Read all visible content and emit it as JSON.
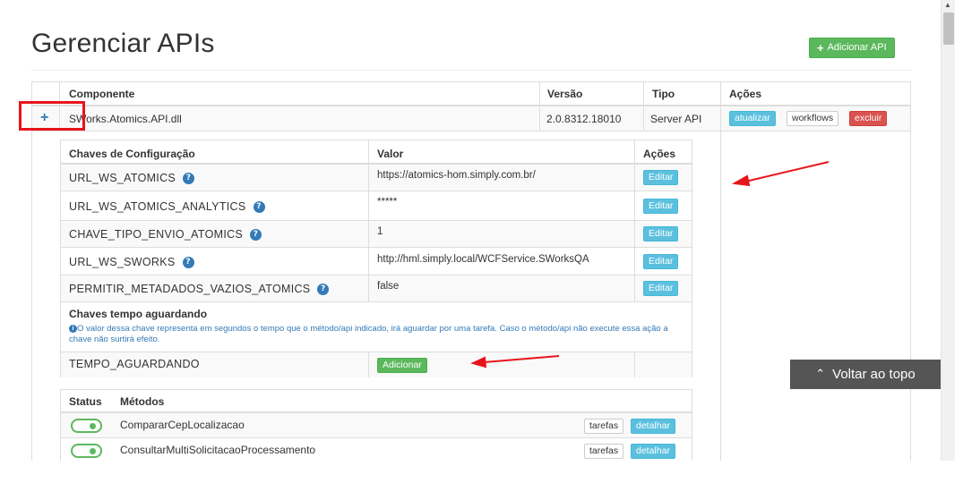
{
  "page": {
    "title": "Gerenciar APIs",
    "add_api_label": "Adicionar API",
    "back_to_top_label": "Voltar ao topo"
  },
  "colors": {
    "primary": "#337ab7",
    "success": "#5cb85c",
    "info": "#5bc0de",
    "danger": "#d9534f",
    "annotation_red": "#e8141b"
  },
  "main_table": {
    "headers": {
      "componente": "Componente",
      "versao": "Versão",
      "tipo": "Tipo",
      "acoes": "Ações"
    },
    "row": {
      "componente": "SWorks.Atomics.API.dll",
      "versao": "2.0.8312.18010",
      "tipo": "Server API",
      "actions": {
        "atualizar": "atualizar",
        "workflows": "workflows",
        "excluir": "excluir"
      }
    }
  },
  "config_table": {
    "headers": {
      "chave": "Chaves de Configuração",
      "valor": "Valor",
      "acoes": "Ações"
    },
    "edit_label": "Editar",
    "rows": [
      {
        "key": "URL_WS_ATOMICS",
        "value": "https://atomics-hom.simply.com.br/"
      },
      {
        "key": "URL_WS_ATOMICS_ANALYTICS",
        "value": "*****"
      },
      {
        "key": "CHAVE_TIPO_ENVIO_ATOMICS",
        "value": "1"
      },
      {
        "key": "URL_WS_SWORKS",
        "value": "http://hml.simply.local/WCFService.SWorksQA"
      },
      {
        "key": "PERMITIR_METADADOS_VAZIOS_ATOMICS",
        "value": "false"
      }
    ],
    "waiting": {
      "title": "Chaves tempo aguardando",
      "note": "O valor dessa chave representa em segundos o tempo que o método/api indicado, irá aguardar por uma tarefa. Caso o método/api não execute essa ação a chave não surtirá efeito.",
      "key": "TEMPO_AGUARDANDO",
      "add_label": "Adicionar"
    }
  },
  "methods_table": {
    "headers": {
      "status": "Status",
      "metodos": "Métodos"
    },
    "tarefas_label": "tarefas",
    "detalhar_label": "detalhar",
    "rows": [
      {
        "name": "CompararCepLocalizacao",
        "enabled": true
      },
      {
        "name": "ConsultarMultiSolicitacaoProcessamento",
        "enabled": true
      }
    ]
  },
  "icons": {
    "expand": "plus-icon",
    "help": "question-circle-icon",
    "info": "info-circle-icon",
    "back_to_top": "chevron-up-icon"
  }
}
